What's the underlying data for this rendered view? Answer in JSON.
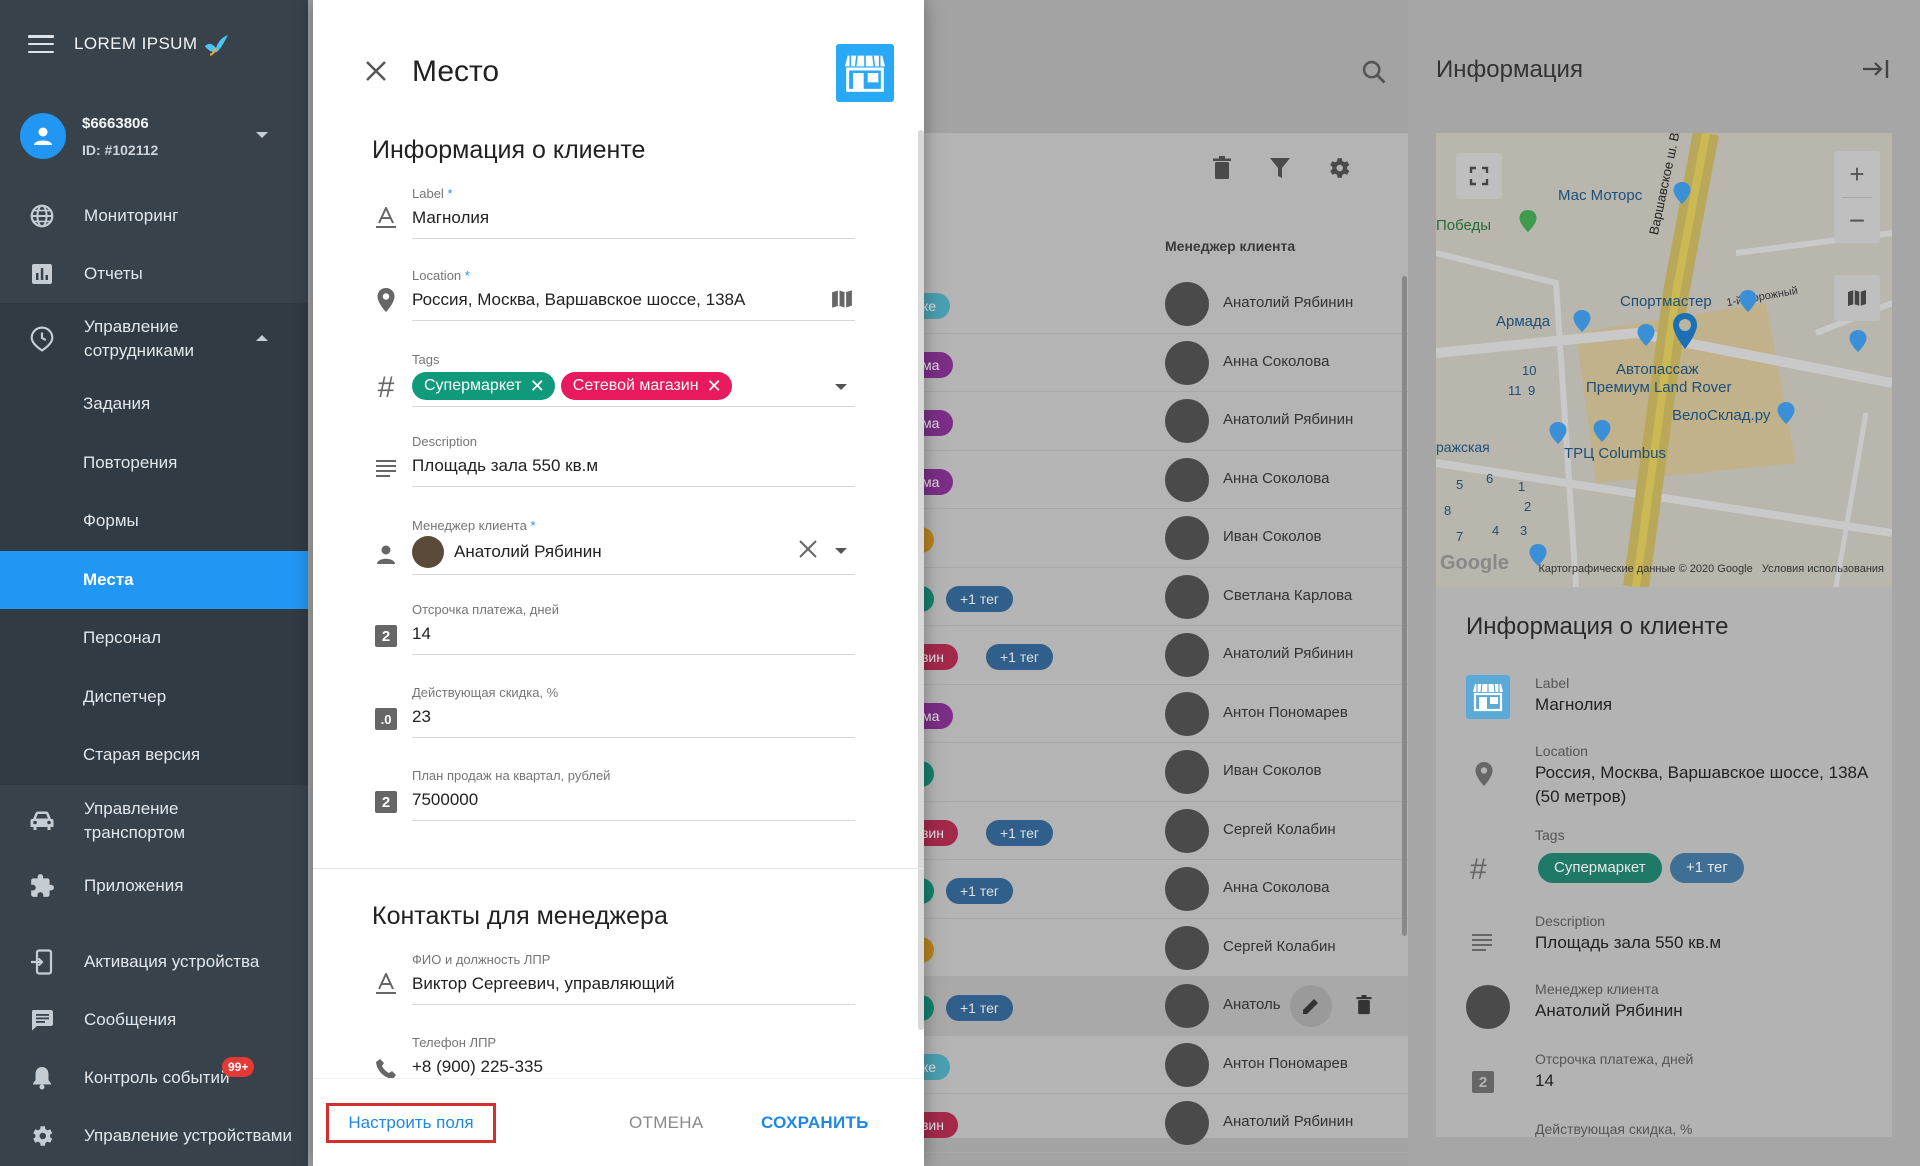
{
  "sidebar": {
    "brand": "LOREM IPSUM",
    "account": {
      "balance": "$6663806",
      "id": "ID: #102112"
    },
    "items": [
      {
        "label": "Мониторинг"
      },
      {
        "label": "Отчеты"
      },
      {
        "label": "Управление сотрудниками"
      }
    ],
    "subitems": [
      {
        "label": "Задания"
      },
      {
        "label": "Повторения"
      },
      {
        "label": "Формы"
      },
      {
        "label": "Места"
      },
      {
        "label": "Персонал"
      },
      {
        "label": "Диспетчер"
      },
      {
        "label": "Старая версия"
      }
    ],
    "items2": [
      {
        "label": "Управление транспортом"
      },
      {
        "label": "Приложения"
      },
      {
        "label": "Активация устройства"
      },
      {
        "label": "Сообщения"
      },
      {
        "label": "Контроль событий"
      },
      {
        "label": "Управление устройствами"
      }
    ],
    "events_badge": "99+"
  },
  "background_table": {
    "column_header": "Менеджер клиента",
    "rows": [
      {
        "tag": "ке",
        "tag_color": "#4a9fb0",
        "extra": "",
        "manager": "Анатолий Рябинин"
      },
      {
        "tag": "ма",
        "tag_color": "#7b2e86",
        "extra": "",
        "manager": "Анна Соколова"
      },
      {
        "tag": "ма",
        "tag_color": "#7b2e86",
        "extra": "",
        "manager": "Анатолий Рябинин"
      },
      {
        "tag": "ма",
        "tag_color": "#7b2e86",
        "extra": "",
        "manager": "Анна Соколова"
      },
      {
        "tag": "",
        "tag_color": "#b88420",
        "extra": "",
        "manager": "Иван Соколов"
      },
      {
        "tag": "",
        "tag_color": "#16806a",
        "extra": "+1 тег",
        "manager": "Светлана Карлова"
      },
      {
        "tag": "зин",
        "tag_color": "#a3294b",
        "extra": "+1 тег",
        "manager": "Анатолий Рябинин"
      },
      {
        "tag": "ма",
        "tag_color": "#7b2e86",
        "extra": "",
        "manager": "Антон Пономарев"
      },
      {
        "tag": "",
        "tag_color": "#16806a",
        "extra": "",
        "manager": "Иван Соколов"
      },
      {
        "tag": "зин",
        "tag_color": "#a3294b",
        "extra": "+1 тег",
        "manager": "Сергей Колабин"
      },
      {
        "tag": "",
        "tag_color": "#16806a",
        "extra": "+1 тег",
        "manager": "Анна Соколова"
      },
      {
        "tag": "",
        "tag_color": "#b88420",
        "extra": "",
        "manager": "Сергей Колабин"
      },
      {
        "tag": "",
        "tag_color": "#16806a",
        "extra": "+1 тег",
        "manager": "Анатоль"
      },
      {
        "tag": "ке",
        "tag_color": "#4a9fb0",
        "extra": "",
        "manager": "Антон Пономарев"
      },
      {
        "tag": "зин",
        "tag_color": "#a3294b",
        "extra": "",
        "manager": "Анатолий Рябинин"
      }
    ]
  },
  "info_panel": {
    "title": "Информация",
    "map": {
      "labels": [
        "Мас Моторс",
        "Победы",
        "Варшавское ш. Вл",
        "Спортмастер",
        "Армада",
        "Автопассаж",
        "Премиум Land Rover",
        "ВелоСклад.ру",
        "ражская",
        "ТРЦ Columbus",
        "1-й Дорожный"
      ],
      "copyright": "Картографические данные © 2020 Google",
      "terms": "Условия использования",
      "google": "Google"
    },
    "card_title": "Информация о клиенте",
    "fields": [
      {
        "label": "Label",
        "value": "Магнолия"
      },
      {
        "label": "Location",
        "value": "Россия, Москва, Варшавское шоссе, 138А (50 метров)"
      },
      {
        "label": "Tags",
        "chip1": "Супермаркет",
        "chip2": "+1 тег"
      },
      {
        "label": "Description",
        "value": "Площадь зала 550 кв.м"
      },
      {
        "label": "Менеджер клиента",
        "value": "Анатолий Рябинин"
      },
      {
        "label": "Отсрочка платежа, дней",
        "value": "14"
      },
      {
        "label": "Действующая скидка, %",
        "value": ""
      }
    ]
  },
  "dialog": {
    "title": "Место",
    "section1": "Информация о клиенте",
    "fields": [
      {
        "label": "Label",
        "required": "*",
        "value": "Магнолия"
      },
      {
        "label": "Location",
        "required": "*",
        "value": "Россия, Москва, Варшавское шоссе, 138А"
      },
      {
        "label": "Tags",
        "tags": [
          "Супермаркет",
          "Сетевой магазин"
        ]
      },
      {
        "label": "Description",
        "value": "Площадь зала 550 кв.м"
      },
      {
        "label": "Менеджер клиента",
        "required": "*",
        "value": "Анатолий Рябинин"
      },
      {
        "label": "Отсрочка платежа, дней",
        "value": "14"
      },
      {
        "label": "Действующая скидка, %",
        "value": "23"
      },
      {
        "label": "План продаж на квартал, рублей",
        "value": "7500000"
      }
    ],
    "section2": "Контакты для менеджера",
    "contacts": [
      {
        "label": "ФИО и должность ЛПР",
        "value": "Виктор Сергеевич, управляющий"
      },
      {
        "label": "Телефон ЛПР",
        "value": "+8 (900) 225-335"
      }
    ],
    "footer": {
      "configure": "Настроить поля",
      "cancel": "ОТМЕНА",
      "save": "СОХРАНИТЬ"
    }
  },
  "colors": {
    "accent": "#2196f3",
    "tag_green": "#0f9a7c",
    "tag_pink": "#e8195c",
    "highlight": "#d32f2f"
  }
}
